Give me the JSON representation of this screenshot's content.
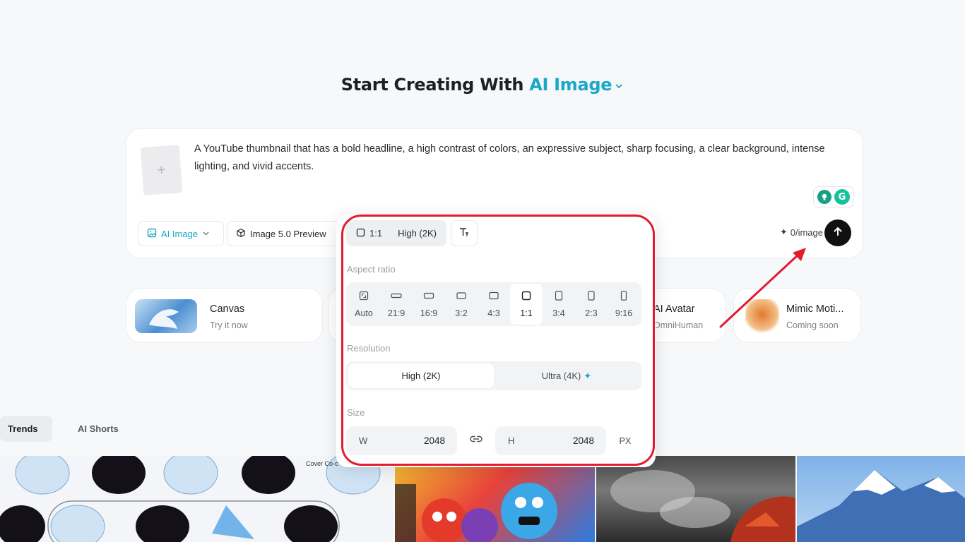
{
  "header": {
    "title_prefix": "Start Creating With",
    "title_accent": "AI Image"
  },
  "prompt": {
    "text": "A YouTube thumbnail that has a bold headline, a high contrast of colors, an expressive subject, sharp focusing, a clear background, intense lighting, and vivid accents.",
    "upload_icon": "plus-icon"
  },
  "toolbar": {
    "mode_label": "AI Image",
    "model_label": "Image 5.0 Preview",
    "credits_label": "0/image",
    "accent_color": "#1aa7c8"
  },
  "settings": {
    "current_ratio": "1:1",
    "current_quality": "High (2K)",
    "aspect_ratio_label": "Aspect ratio",
    "ratios": [
      {
        "label": "Auto"
      },
      {
        "label": "21:9"
      },
      {
        "label": "16:9"
      },
      {
        "label": "3:2"
      },
      {
        "label": "4:3"
      },
      {
        "label": "1:1"
      },
      {
        "label": "3:4"
      },
      {
        "label": "2:3"
      },
      {
        "label": "9:16"
      }
    ],
    "selected_ratio": "1:1",
    "resolution_label": "Resolution",
    "resolutions": [
      {
        "label": "High (2K)"
      },
      {
        "label": "Ultra (4K)"
      }
    ],
    "selected_resolution": "High (2K)",
    "size_label": "Size",
    "width_label": "W",
    "width_value": "2048",
    "height_label": "H",
    "height_value": "2048",
    "unit": "PX"
  },
  "tools": [
    {
      "title": "Canvas",
      "subtitle": "Try it now"
    },
    {
      "title": "AI Avatar",
      "subtitle": "OmniHuman"
    },
    {
      "title": "Mimic Moti...",
      "subtitle": "Coming soon"
    }
  ],
  "feed_tabs": [
    {
      "label": "Trends"
    },
    {
      "label": "AI Shorts"
    }
  ],
  "gallery": {
    "first_caption": "Cover Co-c"
  },
  "annotation_color": "#e41b2f"
}
